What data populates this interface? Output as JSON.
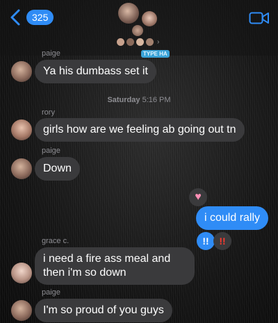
{
  "header": {
    "unread_count": "325",
    "back_icon": "chevron-left-icon",
    "video_icon": "video-camera-icon",
    "group_sticker": "TYPE HA",
    "accent": "#2f8cf6"
  },
  "timestamp": {
    "day": "Saturday",
    "time": "5:16 PM"
  },
  "messages": [
    {
      "sender": "paige",
      "text": "Ya his dumbass set it"
    },
    {
      "sender": "rory",
      "text": "girls how are we feeling ab going out tn"
    },
    {
      "sender": "paige",
      "text": "Down"
    },
    {
      "sender": "me",
      "text": "i could rally",
      "tapback": "heart"
    },
    {
      "sender": "grace c.",
      "text": "i need a fire ass meal and then i'm so down",
      "tapbacks": [
        "double-exclamation",
        "double-exclamation"
      ]
    },
    {
      "sender": "paige",
      "text": "I'm so proud of you guys"
    }
  ]
}
